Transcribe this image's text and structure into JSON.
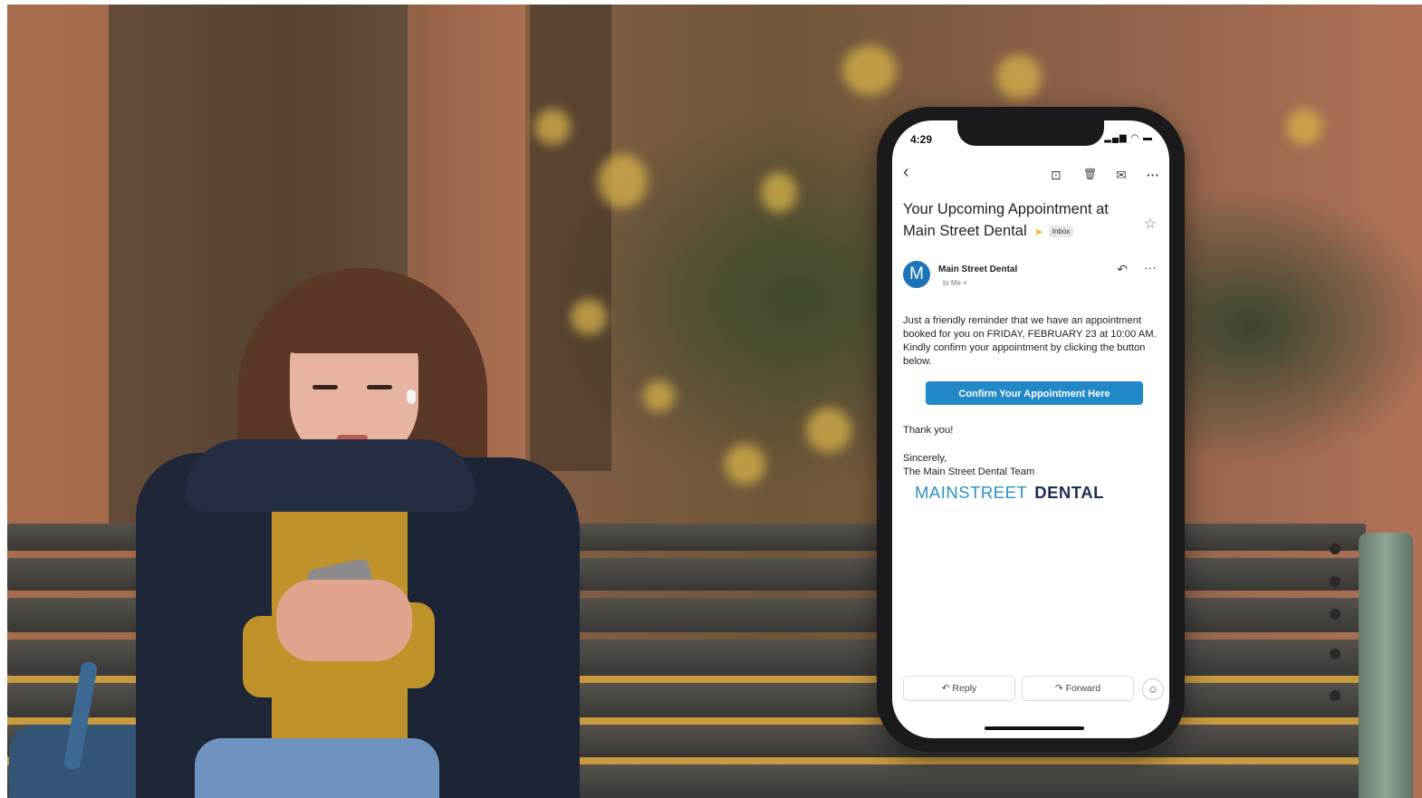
{
  "status_bar": {
    "time": "4:29",
    "icons": "▂▄▆ ◠ ▬"
  },
  "toolbar": {
    "back_icon": "‹",
    "archive_icon": "⊡",
    "delete_icon": "🗑",
    "mark_unread_icon": "✉",
    "more_icon": "···"
  },
  "email": {
    "subject": "Your Upcoming Appointment at Main Street Dental",
    "label": "Inbox",
    "sender_initial": "M",
    "sender_name": "Main Street Dental",
    "recipient": "to Me  ˅",
    "body": "Just a friendly reminder that we have an appointment booked for you on FRIDAY, FEBRUARY 23 at 10:00 AM. Kindly confirm your appointment by clicking the button below.",
    "confirm_label": "Confirm Your Appointment Here",
    "thanks": "Thank you!",
    "closing": "Sincerely,",
    "signature": "The Main Street Dental Team",
    "logo_part1": "MAINSTREET",
    "logo_part2": "DENTAL"
  },
  "actions": {
    "reply_label": "↶  Reply",
    "forward_label": "↷  Forward",
    "emoji_icon": "☺"
  },
  "colors": {
    "accent": "#2289c8",
    "avatar": "#1b73b9",
    "logo_blue": "#2b8fc4",
    "logo_navy": "#1d2f55"
  }
}
